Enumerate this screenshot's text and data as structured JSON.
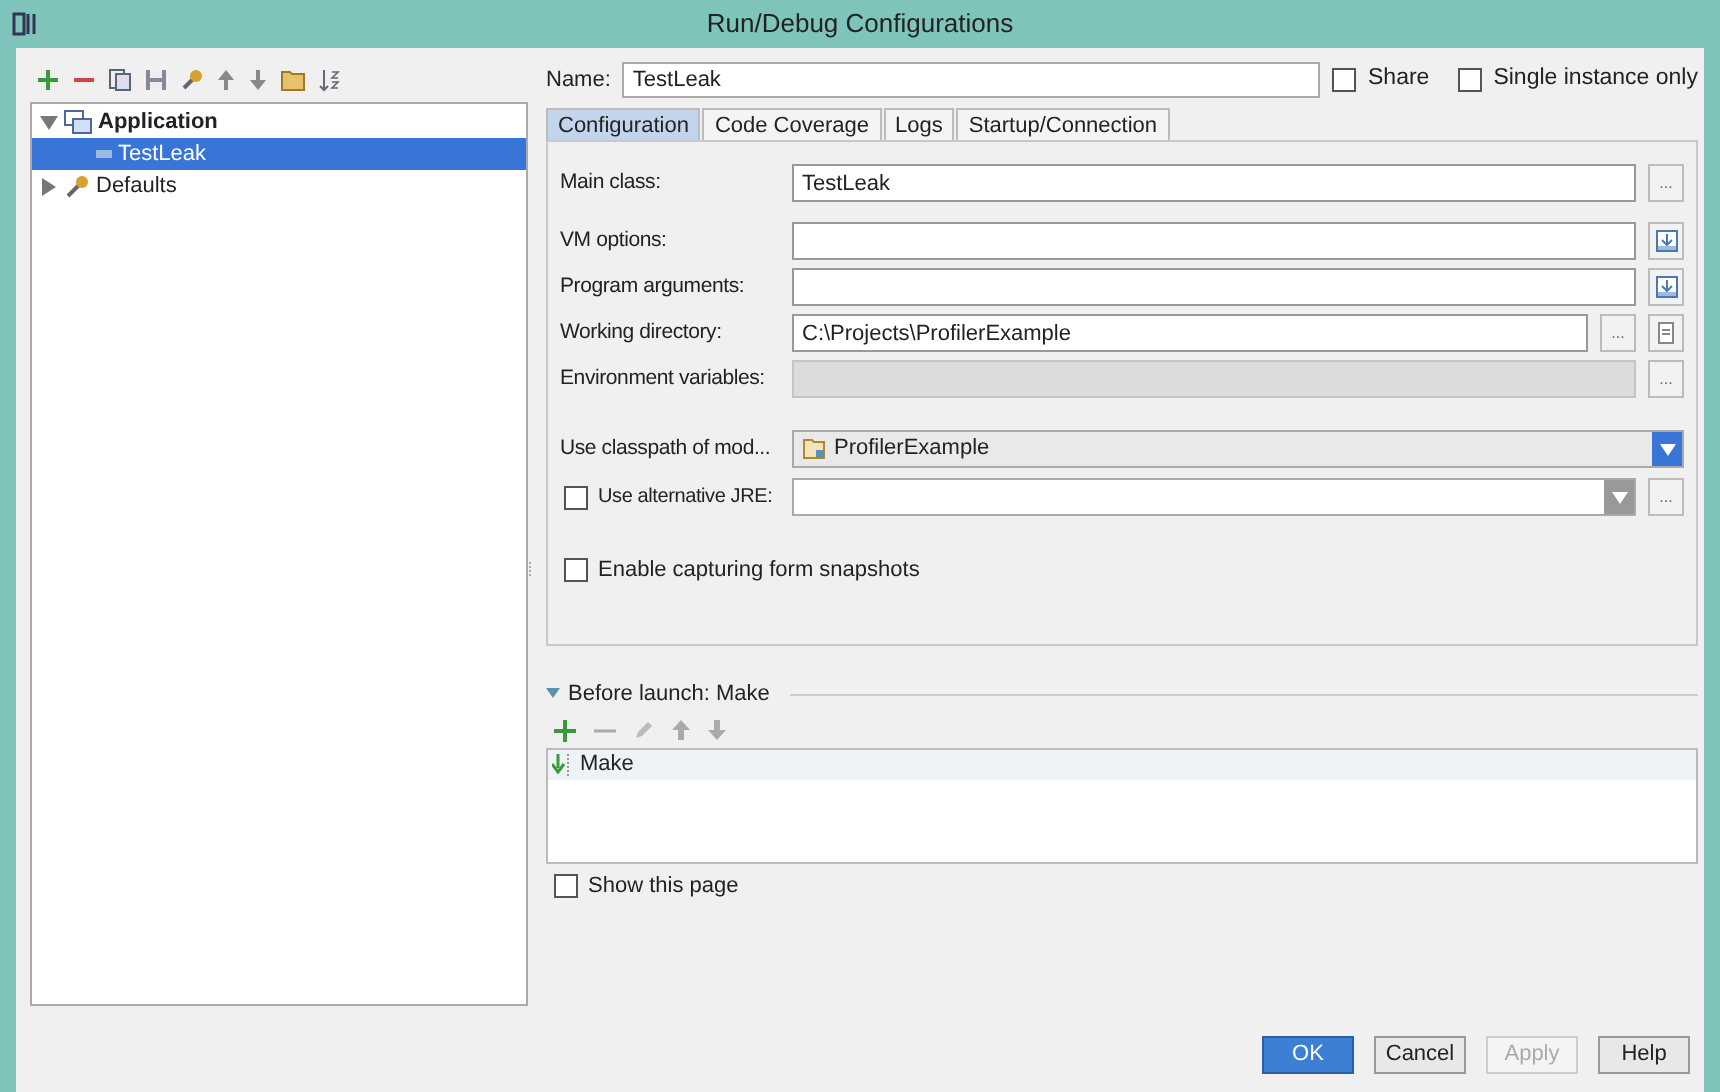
{
  "window": {
    "title": "Run/Debug Configurations"
  },
  "tree": [
    {
      "label": "Application",
      "kind": "application",
      "expanded": true,
      "selected": false,
      "children": [
        {
          "label": "TestLeak",
          "kind": "config",
          "selected": true
        }
      ]
    },
    {
      "label": "Defaults",
      "kind": "defaults",
      "expanded": false,
      "selected": false
    }
  ],
  "name_field": {
    "label": "Name:",
    "value": "TestLeak"
  },
  "options": [
    {
      "label": "Share",
      "checked": false
    },
    {
      "label": "Single instance only",
      "checked": false
    }
  ],
  "tabs": [
    {
      "label": "Configuration",
      "selected": true
    },
    {
      "label": "Code Coverage",
      "selected": false
    },
    {
      "label": "Logs",
      "selected": false
    },
    {
      "label": "Startup/Connection",
      "selected": false
    }
  ],
  "fields": [
    {
      "kind": "text",
      "label": "Main class:",
      "value": "TestLeak",
      "disabled": false,
      "actions": [
        {
          "kind": "browse",
          "label": "..."
        }
      ]
    },
    {
      "kind": "text",
      "label": "VM options:",
      "disabled": false,
      "actions": [
        {
          "kind": "expand"
        }
      ]
    },
    {
      "kind": "text",
      "label": "Program arguments:",
      "disabled": false,
      "actions": [
        {
          "kind": "expand"
        }
      ]
    },
    {
      "kind": "text",
      "label": "Working directory:",
      "value": "C:\\Projects\\ProfilerExample",
      "disabled": false,
      "actions": [
        {
          "kind": "browse",
          "label": "..."
        },
        {
          "kind": "macro"
        }
      ]
    },
    {
      "kind": "text",
      "label": "Environment variables:",
      "disabled": true,
      "actions": [
        {
          "kind": "browse",
          "label": "..."
        }
      ]
    },
    {
      "kind": "module",
      "label": "Use classpath of mod...",
      "value": "ProfilerExample"
    },
    {
      "kind": "jre",
      "label": "Use alternative JRE:",
      "checked": false,
      "actions": [
        {
          "kind": "browse",
          "label": "..."
        }
      ]
    },
    {
      "kind": "checkbox",
      "label": "Enable capturing form snapshots",
      "checked": false
    }
  ],
  "before_launch": {
    "title": "Before launch: Make",
    "expanded": true,
    "tasks": [
      {
        "label": "Make",
        "selected": false
      }
    ]
  },
  "show_page": {
    "label": "Show this page",
    "checked": false
  },
  "buttons": [
    {
      "label": "OK",
      "kind": "primary",
      "disabled": false
    },
    {
      "label": "Cancel",
      "kind": "normal",
      "disabled": false
    },
    {
      "label": "Apply",
      "kind": "normal",
      "disabled": true
    },
    {
      "label": "Help",
      "kind": "normal",
      "disabled": false
    }
  ]
}
